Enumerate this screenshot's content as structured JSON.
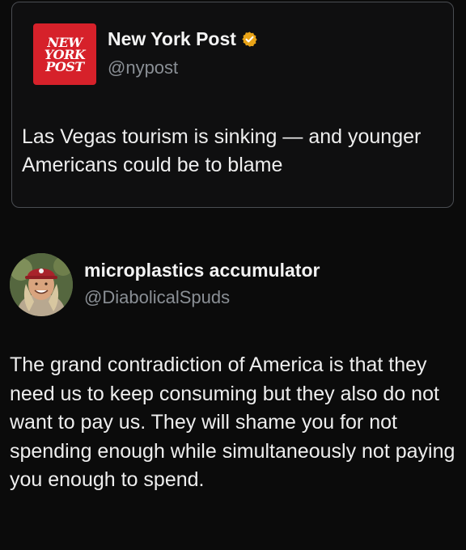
{
  "quoted_post": {
    "logo_lines": [
      "NEW",
      "YORK",
      "POST"
    ],
    "author_name": "New York Post",
    "author_handle": "@nypost",
    "verified_icon": "verified-badge-gold",
    "text": "Las Vegas tourism is sinking — and younger Americans could be to blame"
  },
  "reply_post": {
    "author_name": "microplastics accumulator",
    "author_handle": "@DiabolicalSpuds",
    "avatar_icon": "user-avatar",
    "text": "The grand contradiction of America is that they need us to keep consuming but they also do not want to pay us. They will shame you for not spending enough while simultaneously not paying you enough to spend."
  },
  "colors": {
    "background": "#0b0b0b",
    "nyp_red": "#d6212a",
    "verified_gold": "#e8a317",
    "handle_gray": "#8a8f95"
  }
}
